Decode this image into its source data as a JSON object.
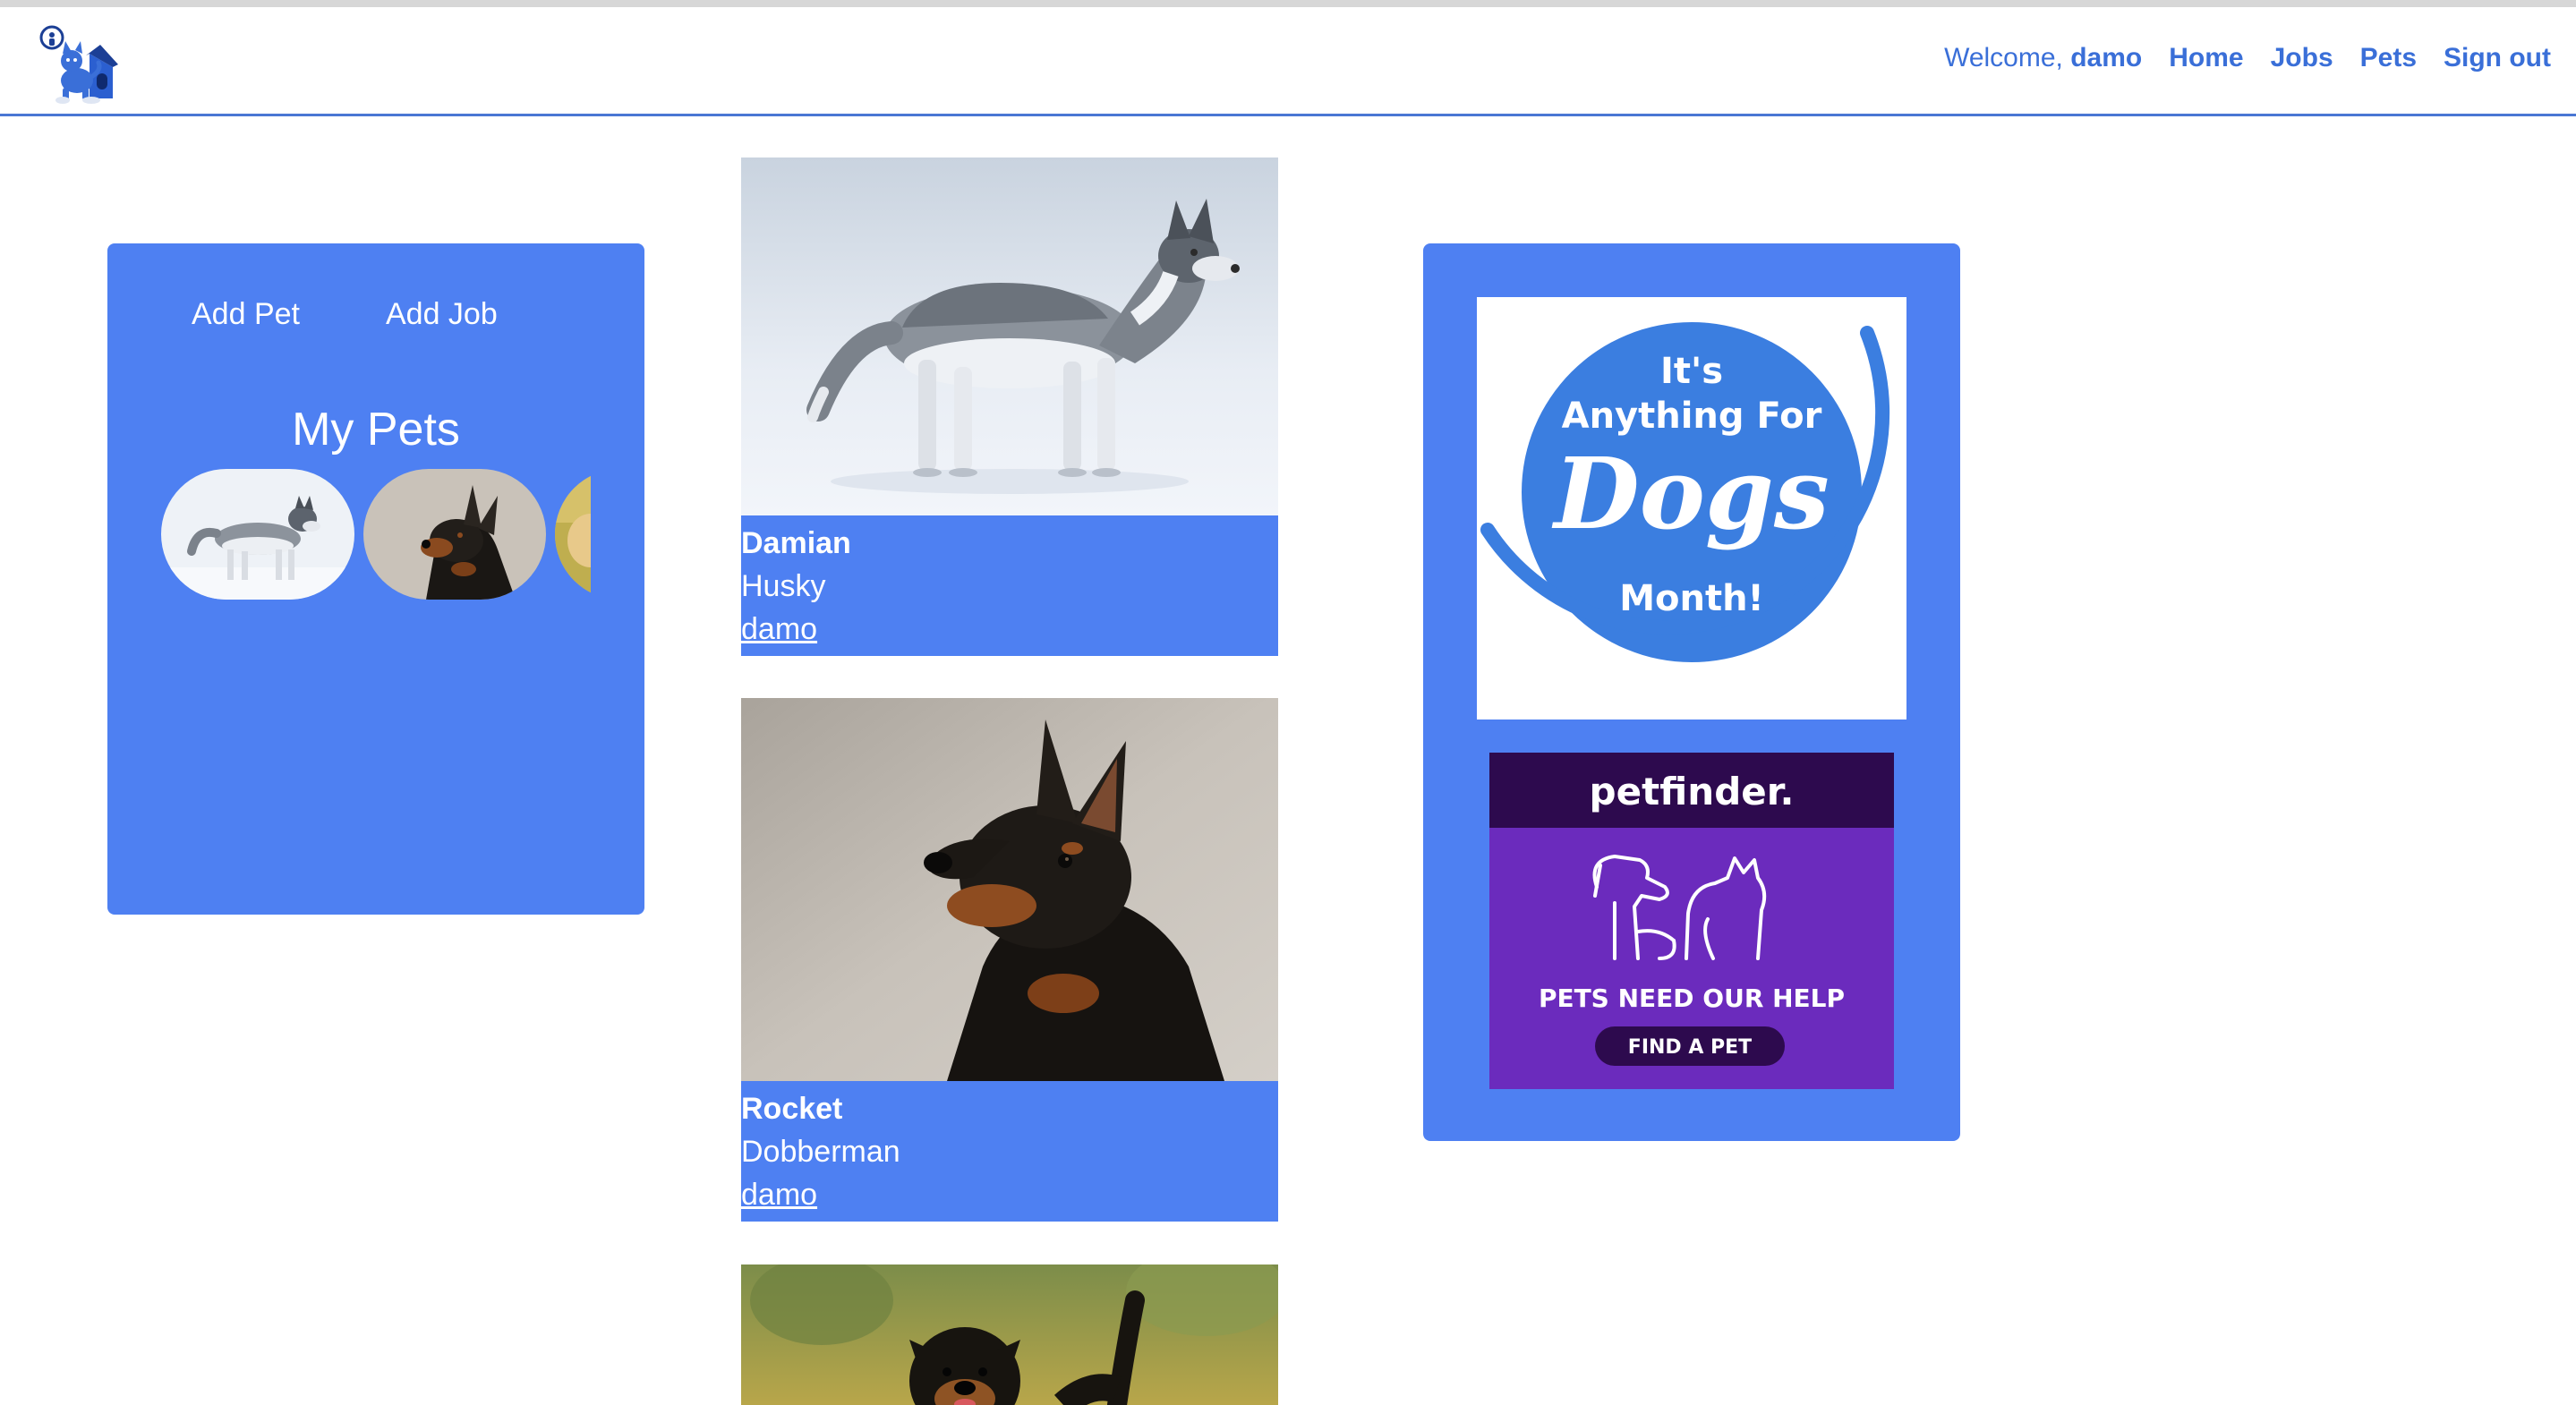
{
  "nav": {
    "welcome_prefix": "Welcome,",
    "username": "damo",
    "links": [
      "Home",
      "Jobs",
      "Pets",
      "Sign out"
    ]
  },
  "sidebar": {
    "add_pet": "Add Pet",
    "add_job": "Add Job",
    "my_pets_title": "My Pets"
  },
  "pets": [
    {
      "name": "Damian",
      "breed": "Husky",
      "owner": "damo"
    },
    {
      "name": "Rocket",
      "breed": "Dobberman",
      "owner": "damo"
    },
    {
      "name": "",
      "breed": "",
      "owner": ""
    }
  ],
  "ads": {
    "dogs_month": {
      "line1": "It's",
      "line2": "Anything For",
      "line3": "Dogs",
      "line4": "Month!"
    },
    "petfinder": {
      "brand": "petfinder.",
      "headline": "PETS NEED OUR HELP",
      "cta": "FIND A PET"
    }
  },
  "colors": {
    "accent": "#3a6fd8",
    "panel": "#4e80f2",
    "petfinder_dark": "#2d0a4e",
    "petfinder_purple": "#6b2bbd"
  },
  "icons": {
    "logo": "dog-house-logo-icon",
    "pet_thumbs": [
      "husky-thumb",
      "doberman-thumb",
      "golden-thumb"
    ]
  }
}
